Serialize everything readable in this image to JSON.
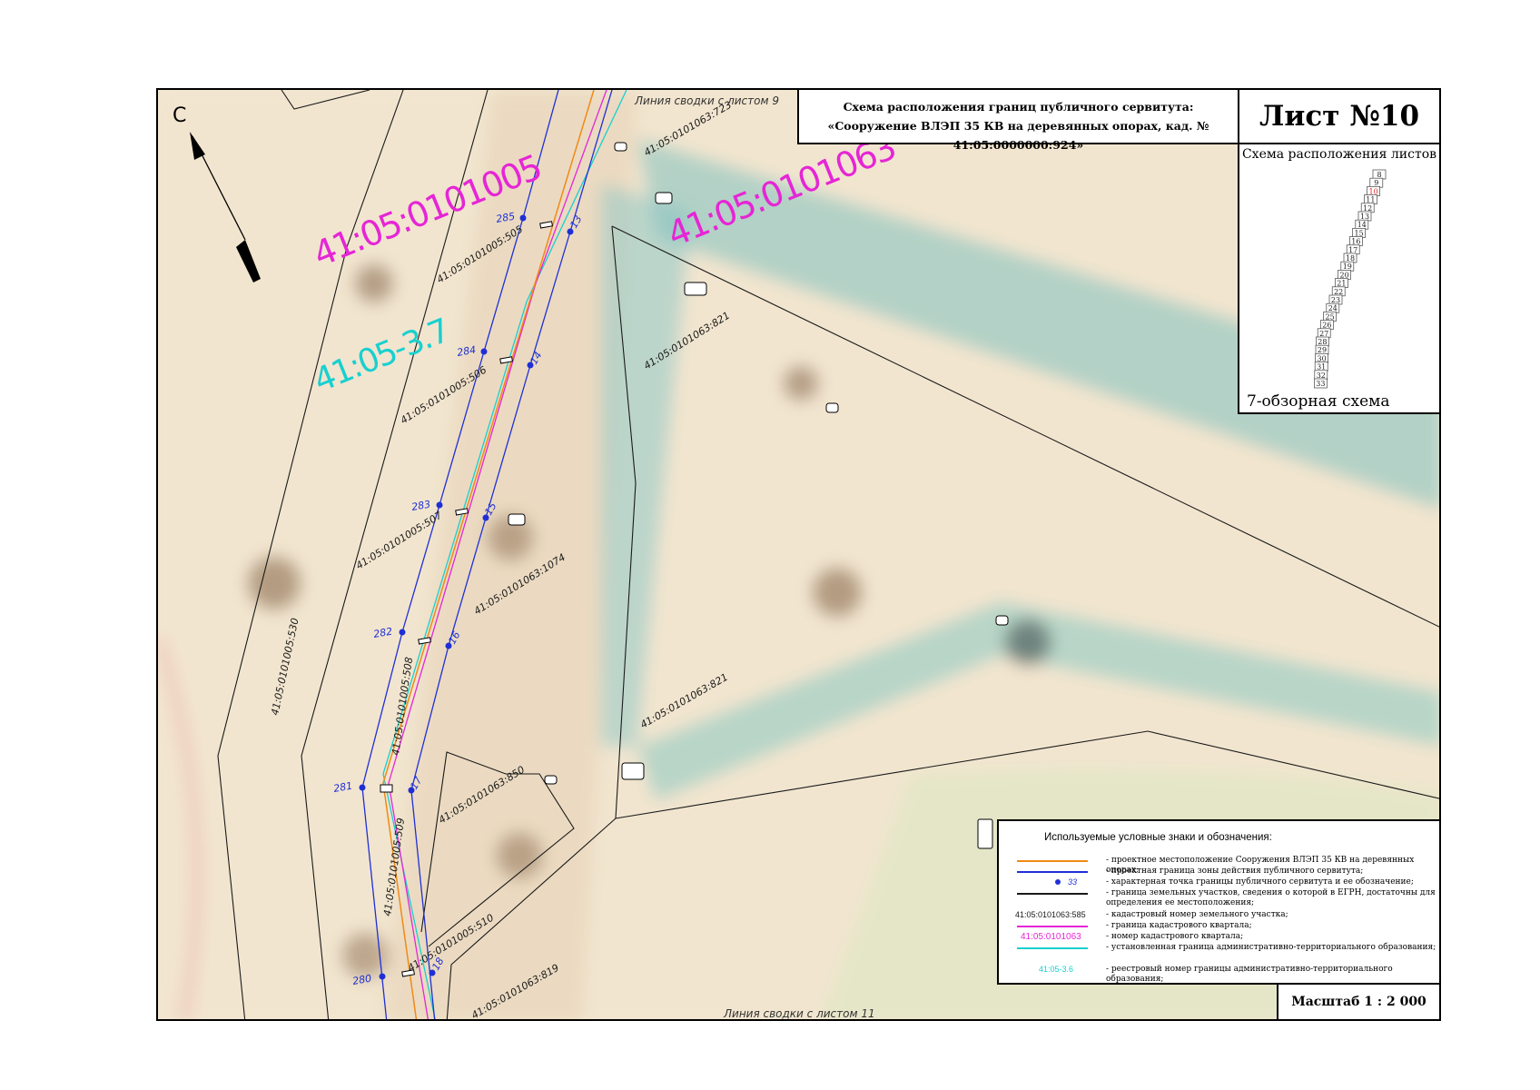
{
  "title": {
    "line1": "Схема расположения границ публичного сервитута:",
    "line2": "«Сооружение ВЛЭП 35 КВ на деревянных опорах, кад. № 41:05:0000000:924»"
  },
  "sheet": {
    "label": "Лист №10"
  },
  "layout": {
    "title": "Схема расположения листов",
    "sheets": [
      "8",
      "9",
      "10",
      "11",
      "12",
      "13",
      "14",
      "15",
      "16",
      "17",
      "18",
      "19",
      "20",
      "21",
      "22",
      "23",
      "24",
      "25",
      "26",
      "27",
      "28",
      "29",
      "30",
      "31",
      "32",
      "33"
    ],
    "current_sheet": "10",
    "footer": "7-обзорная схема"
  },
  "map": {
    "north_label": "С",
    "join_top": "Линия сводки с листом 9",
    "join_bottom": "Линия сводки с листом 11",
    "quarter_left": "41:05:0101005",
    "quarter_right": "41:05:0101063",
    "admin_boundary": "41:05-3.7",
    "point_labels": {
      "p285": "285",
      "p284": "284",
      "p283": "283",
      "p282": "282",
      "p281": "281",
      "p280": "280",
      "p13": "13",
      "p14": "14",
      "p15": "15",
      "p16": "16",
      "p17": "17",
      "p18": "18"
    },
    "parcels": {
      "p505": "41:05:0101005:505",
      "p506": "41:05:0101005:506",
      "p507": "41:05:0101005:507",
      "p508": "41:05:0101005:508",
      "p509": "41:05:0101005:509",
      "p510": "41:05:0101005:510",
      "p530": "41:05:0101005:530",
      "p723": "41:05:0101063:723",
      "p821a": "41:05:0101063:821",
      "p821b": "41:05:0101063:821",
      "p1074": "41:05:0101063:1074",
      "p850": "41:05:0101063:850",
      "p819": "41:05:0101063:819"
    }
  },
  "legend": {
    "title": "Используемые условные знаки и обозначения:",
    "items": [
      {
        "symbol": "",
        "text": "- проектное местоположение Сооружения ВЛЭП 35 КВ на деревянных опорах;"
      },
      {
        "symbol": "",
        "text": "- проектная граница зоны действия публичного сервитута;"
      },
      {
        "symbol": "33",
        "text": "- характерная точка границы публичного сервитута и ее обозначение;"
      },
      {
        "symbol": "",
        "text": "- граница земельных участков, сведения о которой в ЕГРН, достаточны для определения ее местоположения;"
      },
      {
        "symbol": "41:05:0101063:585",
        "text": "- кадастровый номер земельного участка;"
      },
      {
        "symbol": "",
        "text": "- граница кадастрового квартала;"
      },
      {
        "symbol": "41:05:0101063",
        "text": "- номер кадастрового квартала;"
      },
      {
        "symbol": "",
        "text": "- установленная граница административно-территориального образования;"
      },
      {
        "symbol": "41:05-3.6",
        "text": "- реестровый номер границы административно-территориального образования;"
      }
    ]
  },
  "scale": {
    "label": "Масштаб 1 : 2 000"
  },
  "colors": {
    "power_line": "#f08a16",
    "servitude_boundary": "#1f2fd6",
    "parcel_boundary": "#1a1a1a",
    "quarter_boundary": "#e625d6",
    "admin_boundary": "#18d0d0",
    "background": "#f3e7d2"
  }
}
